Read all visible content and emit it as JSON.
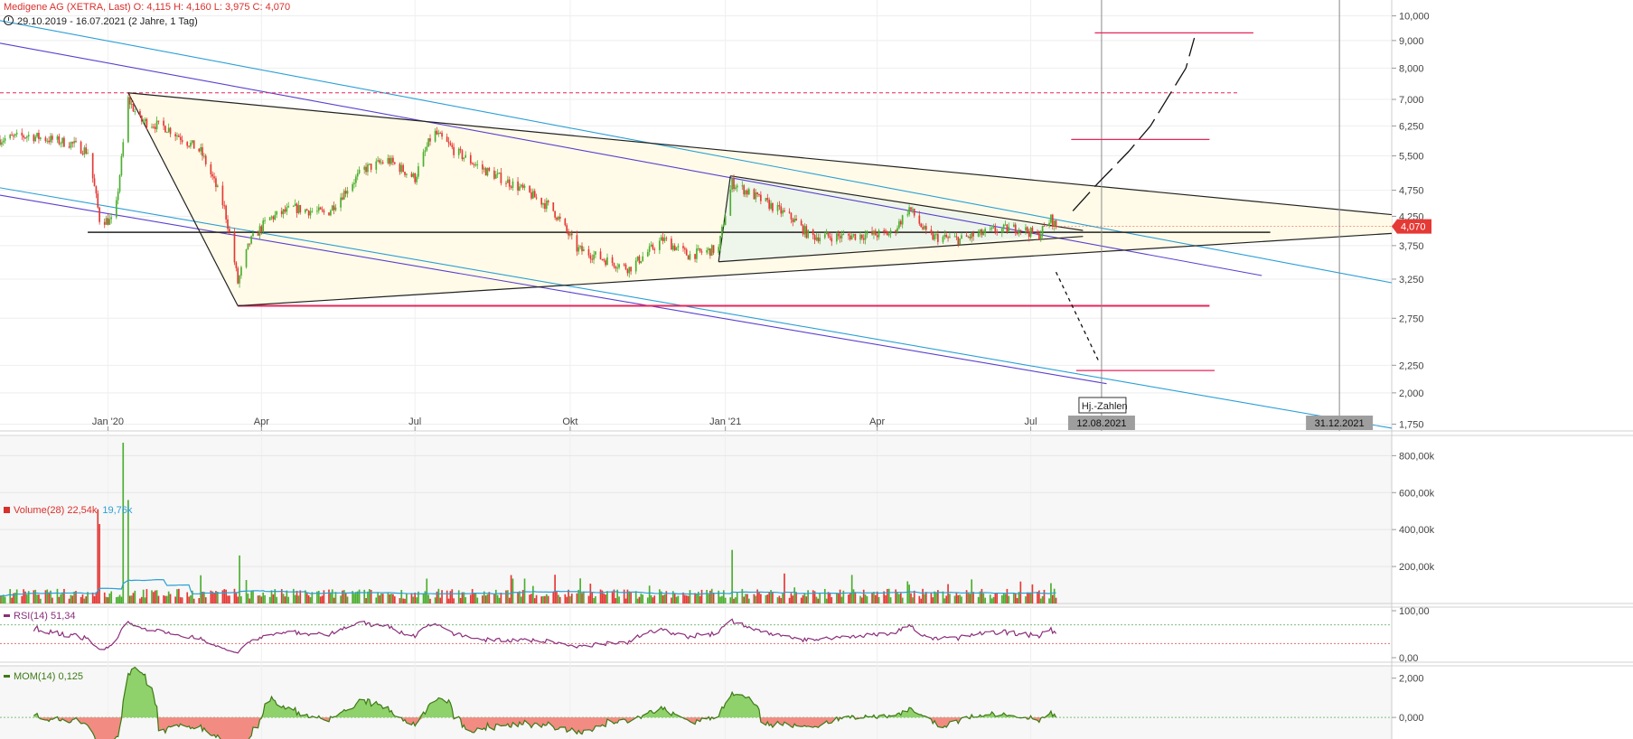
{
  "header": {
    "line1": "Medigene AG (XETRA, Last)  O: 4,115  H: 4,160  L: 3,975  C: 4,070",
    "line2": "29.10.2019 - 16.07.2021  (2 Jahre, 1 Tag)"
  },
  "colors": {
    "up": "#4caf30",
    "down": "#e53935",
    "line_black": "#222222",
    "line_blue": "#2a9fd6",
    "line_purple": "#5a3fcf",
    "target_red": "#e8245a",
    "rsi": "#8b2e7a",
    "mom": "#3d7a16",
    "triangle_fill": "#fffbe8",
    "sub_triangle_fill": "#eef5ea"
  },
  "annotations": {
    "event_label": "Hj.-Zahlen",
    "date_marker_1": "12.08.2021",
    "date_marker_2": "31.12.2021",
    "last_price": "4,070"
  },
  "panels": {
    "volume": {
      "name": "Volume(28)",
      "value1": "22,54k",
      "value2": "19,76k"
    },
    "rsi": {
      "name": "RSI(14)",
      "value": "51,34"
    },
    "mom": {
      "name": "MOM(14)",
      "value": "0,125"
    }
  },
  "chart_data": [
    {
      "type": "candlestick",
      "title": "Medigene AG (XETRA, Last)",
      "x_axis": {
        "type": "date",
        "range": [
          "2019-10-29",
          "2022-01-31"
        ],
        "ticks": [
          {
            "date": "2020-01-01",
            "label": "Jan '20"
          },
          {
            "date": "2020-04-01",
            "label": "Apr"
          },
          {
            "date": "2020-07-01",
            "label": "Jul"
          },
          {
            "date": "2020-10-01",
            "label": "Okt"
          },
          {
            "date": "2021-01-01",
            "label": "Jan '21"
          },
          {
            "date": "2021-04-01",
            "label": "Apr"
          },
          {
            "date": "2021-07-01",
            "label": "Jul"
          }
        ]
      },
      "y_axis": {
        "scale": "log",
        "range": [
          1.7,
          10.7
        ],
        "ticks": [
          "1,750",
          "2,000",
          "2,250",
          "2,750",
          "3,250",
          "3,750",
          "4,250",
          "4,750",
          "5,500",
          "6,250",
          "7,000",
          "8,000",
          "9,000",
          "10,000"
        ],
        "tick_values": [
          1.75,
          2.0,
          2.25,
          2.75,
          3.25,
          3.75,
          4.25,
          4.75,
          5.5,
          6.25,
          7.0,
          8.0,
          9.0,
          10.0
        ]
      },
      "close_anchors": [
        [
          "2019-10-29",
          5.9
        ],
        [
          "2019-11-15",
          6.0
        ],
        [
          "2019-12-10",
          5.8
        ],
        [
          "2019-12-20",
          5.6
        ],
        [
          "2019-12-27",
          4.2
        ],
        [
          "2020-01-05",
          4.15
        ],
        [
          "2020-01-09",
          5.4
        ],
        [
          "2020-01-13",
          7.0
        ],
        [
          "2020-01-20",
          6.4
        ],
        [
          "2020-02-05",
          6.2
        ],
        [
          "2020-02-25",
          5.6
        ],
        [
          "2020-03-10",
          4.4
        ],
        [
          "2020-03-18",
          3.2
        ],
        [
          "2020-03-25",
          3.8
        ],
        [
          "2020-04-05",
          4.2
        ],
        [
          "2020-04-20",
          4.4
        ],
        [
          "2020-05-10",
          4.3
        ],
        [
          "2020-06-01",
          5.2
        ],
        [
          "2020-06-15",
          5.4
        ],
        [
          "2020-07-01",
          5.0
        ],
        [
          "2020-07-12",
          6.1
        ],
        [
          "2020-07-25",
          5.6
        ],
        [
          "2020-08-10",
          5.2
        ],
        [
          "2020-09-01",
          4.8
        ],
        [
          "2020-09-20",
          4.4
        ],
        [
          "2020-10-05",
          3.7
        ],
        [
          "2020-10-25",
          3.5
        ],
        [
          "2020-11-05",
          3.4
        ],
        [
          "2020-11-25",
          3.85
        ],
        [
          "2020-12-10",
          3.6
        ],
        [
          "2020-12-28",
          3.7
        ],
        [
          "2021-01-05",
          4.9
        ],
        [
          "2021-01-20",
          4.6
        ],
        [
          "2021-02-10",
          4.2
        ],
        [
          "2021-02-20",
          3.9
        ],
        [
          "2021-03-10",
          3.9
        ],
        [
          "2021-04-10",
          3.95
        ],
        [
          "2021-04-20",
          4.4
        ],
        [
          "2021-05-01",
          3.9
        ],
        [
          "2021-05-20",
          3.85
        ],
        [
          "2021-06-10",
          4.0
        ],
        [
          "2021-06-25",
          4.05
        ],
        [
          "2021-07-05",
          3.9
        ],
        [
          "2021-07-13",
          4.2
        ],
        [
          "2021-07-16",
          4.07
        ]
      ],
      "last": {
        "date": "2021-07-16",
        "open": 4.115,
        "high": 4.16,
        "low": 3.975,
        "close": 4.07
      },
      "support_level": 3.97,
      "horizontal_lines": [
        {
          "value": 7.2,
          "style": "dashed",
          "color": "red"
        },
        {
          "value": 2.9,
          "style": "solid",
          "color": "red"
        }
      ],
      "target_levels": [
        9.3,
        5.9,
        2.2
      ],
      "vertical_markers": [
        "2021-08-12",
        "2021-12-31"
      ]
    },
    {
      "type": "bar",
      "title": "Volume(28)",
      "y_axis": {
        "ticks": [
          "200,00k",
          "400,00k",
          "600,00k",
          "800,00k"
        ],
        "range": [
          0,
          880000
        ]
      },
      "spikes": [
        [
          "2019-12-26",
          510000
        ],
        [
          "2019-12-27",
          430000
        ],
        [
          "2020-01-10",
          870000
        ],
        [
          "2020-01-13",
          560000
        ],
        [
          "2020-03-19",
          260000
        ],
        [
          "2021-01-05",
          290000
        ],
        [
          "2021-04-19",
          120000
        ],
        [
          "2021-07-13",
          110000
        ]
      ],
      "series": [
        {
          "name": "Volume(28)",
          "last": "22,54k"
        },
        {
          "name": "",
          "last": "19,76k"
        }
      ]
    },
    {
      "type": "line",
      "title": "RSI(14)",
      "y_axis": {
        "ticks": [
          "0,00",
          "100,00"
        ],
        "range": [
          0,
          100
        ]
      },
      "last": "51,34"
    },
    {
      "type": "area",
      "title": "MOM(14)",
      "y_axis": {
        "ticks": [
          "0,000",
          "2,000"
        ],
        "range": [
          -1.1,
          2.4
        ]
      },
      "last": "0,125"
    }
  ]
}
